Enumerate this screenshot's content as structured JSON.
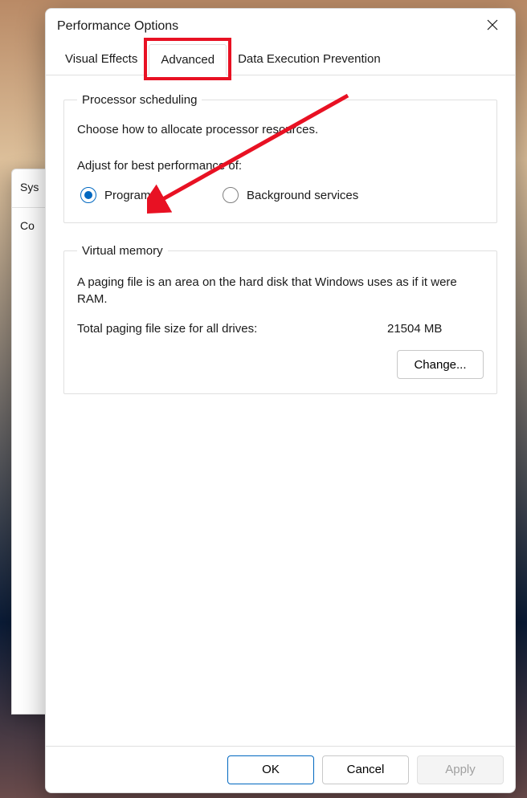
{
  "window": {
    "title": "Performance Options"
  },
  "tabs": {
    "t0": "Visual Effects",
    "t1": "Advanced",
    "t2": "Data Execution Prevention",
    "active": "Advanced"
  },
  "scheduling": {
    "legend": "Processor scheduling",
    "help": "Choose how to allocate processor resources.",
    "adjust": "Adjust for best performance of:",
    "programs": "Programs",
    "background": "Background services",
    "selected": "programs"
  },
  "vm": {
    "legend": "Virtual memory",
    "desc": "A paging file is an area on the hard disk that Windows uses as if it were RAM.",
    "total_label": "Total paging file size for all drives:",
    "total_value": "21504 MB",
    "change": "Change..."
  },
  "buttons": {
    "ok": "OK",
    "cancel": "Cancel",
    "apply": "Apply"
  },
  "background_window": {
    "tab": "Sys",
    "row": "Co"
  },
  "annotation": {
    "highlight_tab": "Advanced",
    "arrow_target": "Programs radio"
  }
}
